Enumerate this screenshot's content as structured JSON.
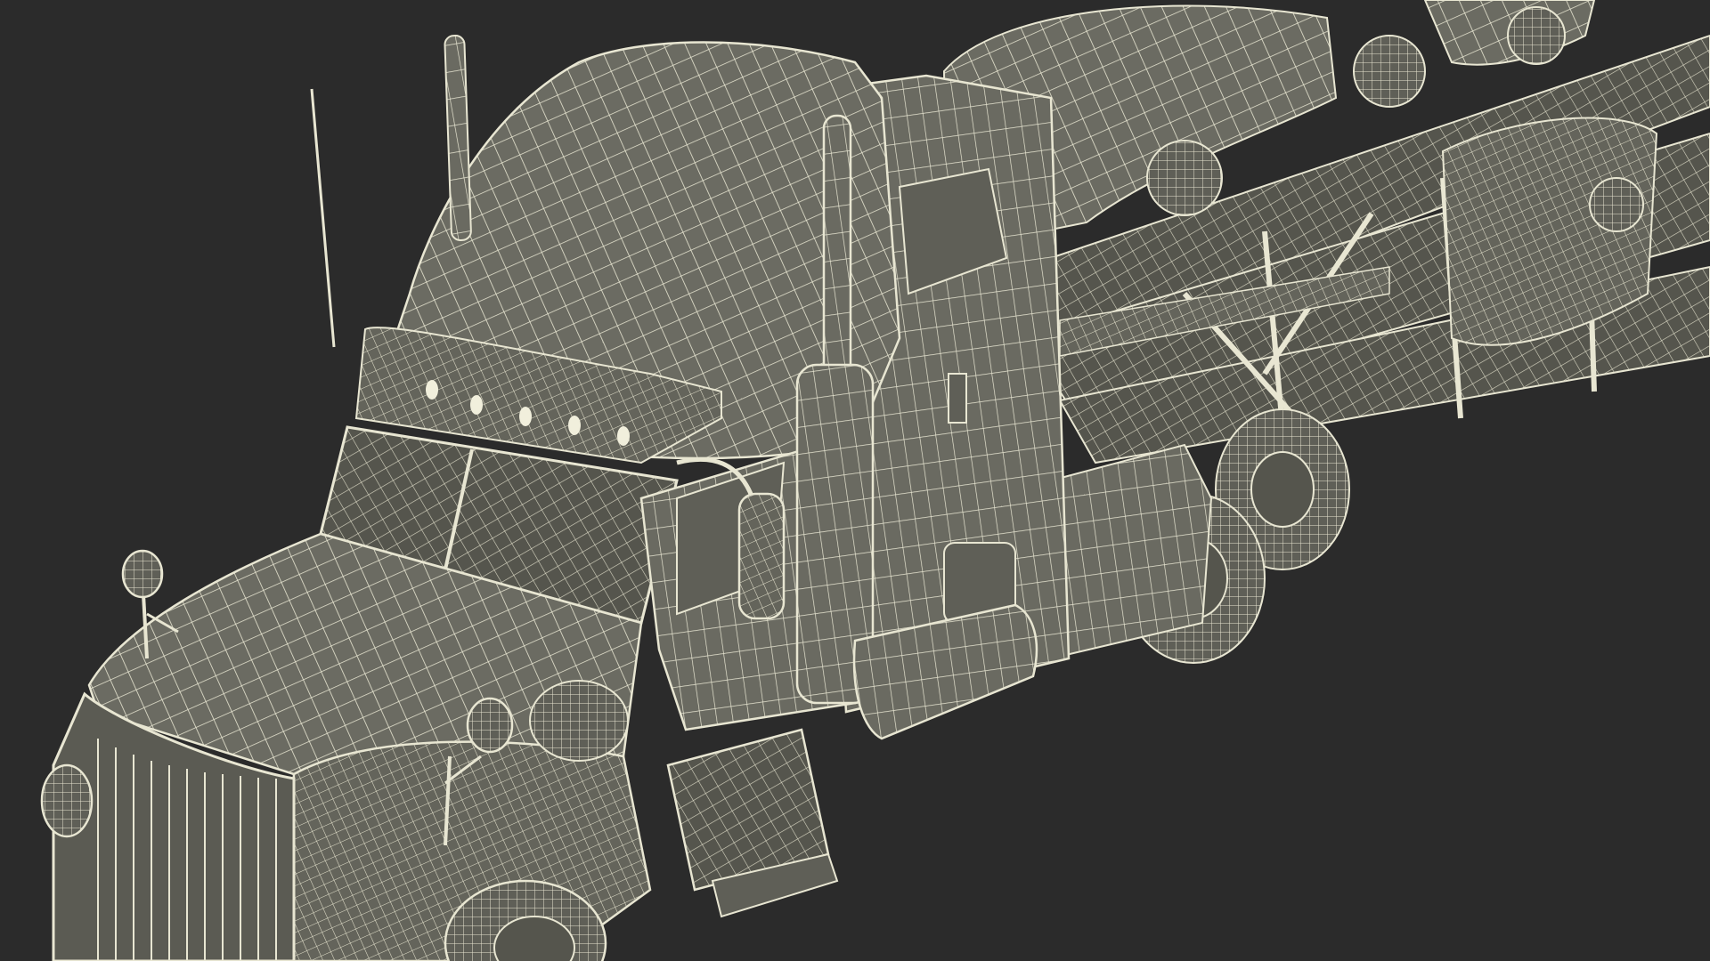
{
  "scene": {
    "subject": "car-carrier-truck-wireframe",
    "colors": {
      "background": "#2b2b2b",
      "surface": "#6e6e64",
      "surface_dark": "#5a5a52",
      "wire": "#e8e6d2"
    }
  }
}
